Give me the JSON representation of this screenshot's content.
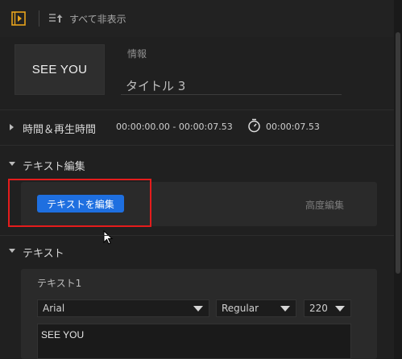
{
  "toolbar": {
    "hide_all_label": "すべて非表示",
    "preview_icon": "film-play-icon",
    "hide_icon": "list-hide-icon"
  },
  "thumbnail": {
    "text": "SEE YOU"
  },
  "info": {
    "label": "情報",
    "title_value": "タイトル 3"
  },
  "time_section": {
    "label": "時間＆再生時間",
    "range": "00:00:00.00 - 00:00:07.53",
    "duration": "00:00:07.53",
    "icon": "stopwatch-icon"
  },
  "text_edit_section": {
    "label": "テキスト編集",
    "edit_button": "テキストを編集",
    "advanced_label": "高度編集"
  },
  "text_section": {
    "label": "テキスト",
    "item_label": "テキスト1",
    "font": "Arial",
    "style": "Regular",
    "size": "220",
    "content": "SEE YOU"
  },
  "colors": {
    "accent": "#1e6fe0",
    "highlight": "#e51c1c",
    "preview_icon": "#e8a31c"
  }
}
